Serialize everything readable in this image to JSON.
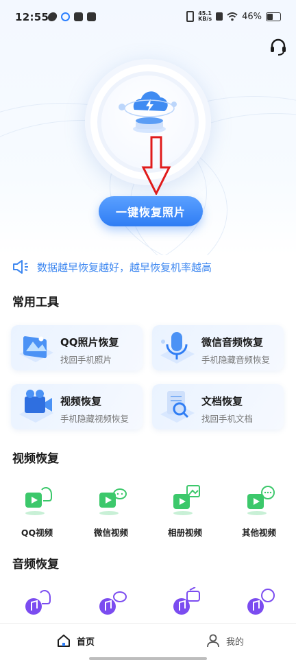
{
  "status_bar": {
    "time": "12:55",
    "net_speed_top": "45.1",
    "net_speed_bottom": "KB/s",
    "battery": "46%"
  },
  "hero": {
    "cta_label": "一键恢复照片"
  },
  "notice": {
    "text": "数据越早恢复越好，越早恢复机率越高"
  },
  "tools": {
    "title": "常用工具",
    "items": [
      {
        "title": "QQ照片恢复",
        "subtitle": "找回手机照片"
      },
      {
        "title": "微信音频恢复",
        "subtitle": "手机隐藏音频恢复"
      },
      {
        "title": "视频恢复",
        "subtitle": "手机隐藏视频恢复"
      },
      {
        "title": "文档恢复",
        "subtitle": "找回手机文档"
      }
    ]
  },
  "video_recovery": {
    "title": "视频恢复",
    "items": [
      {
        "label": "QQ视频"
      },
      {
        "label": "微信视频"
      },
      {
        "label": "相册视频"
      },
      {
        "label": "其他视频"
      }
    ]
  },
  "audio_recovery": {
    "title": "音频恢复"
  },
  "tabbar": {
    "home": "首页",
    "mine": "我的"
  },
  "colors": {
    "accent": "#2f7df4",
    "notice": "#3d87f0",
    "video_icon": "#3cc86b",
    "audio_icon": "#7b4cf0"
  }
}
